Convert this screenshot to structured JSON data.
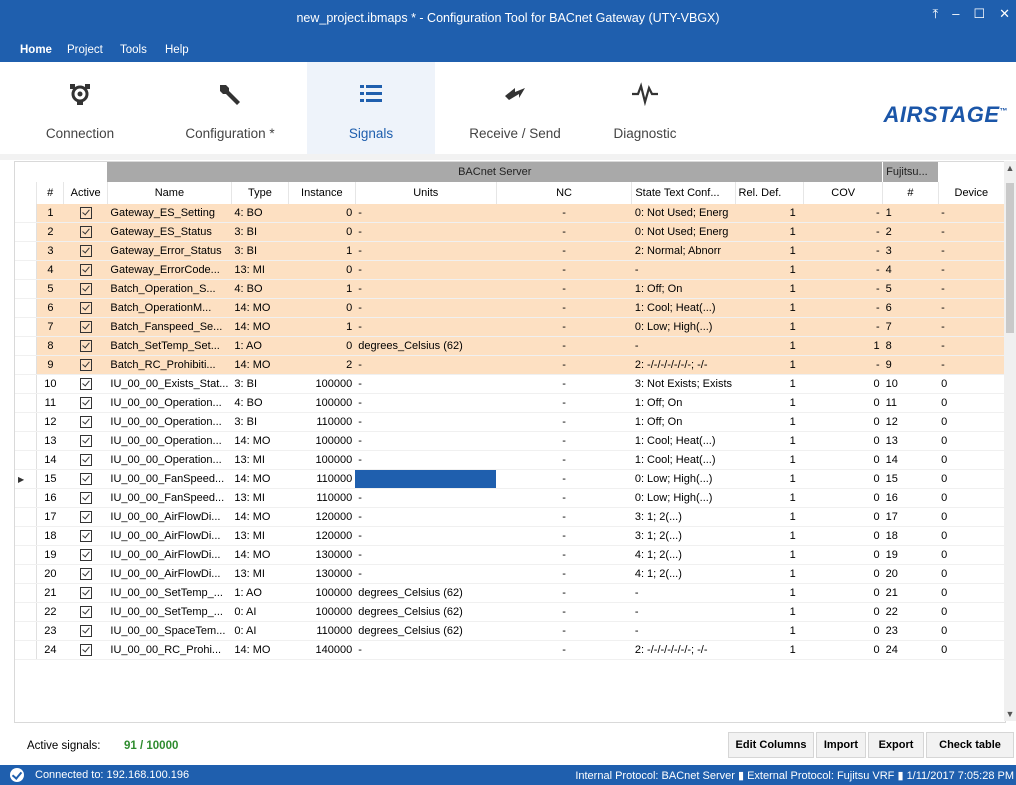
{
  "window": {
    "title": "new_project.ibmaps * - Configuration Tool for BACnet Gateway (UTY-VBGX)"
  },
  "menu": [
    "Home",
    "Project",
    "Tools",
    "Help"
  ],
  "ribbon": {
    "tabs": [
      {
        "label": "Connection",
        "icon": "connection-icon"
      },
      {
        "label": "Configuration *",
        "icon": "wrench-icon"
      },
      {
        "label": "Signals",
        "icon": "list-icon"
      },
      {
        "label": "Receive / Send",
        "icon": "transfer-icon"
      },
      {
        "label": "Diagnostic",
        "icon": "pulse-icon"
      }
    ],
    "active_tab": "Signals",
    "logo": "AIRSTAGE"
  },
  "grid": {
    "group_headers": {
      "bacnet": "BACnet Server",
      "fujitsu": "Fujitsu..."
    },
    "columns": [
      "#",
      "Active",
      "Name",
      "Type",
      "Instance",
      "Units",
      "NC",
      "State Text Conf...",
      "Rel. Def.",
      "COV",
      "#",
      "Device"
    ],
    "rows": [
      {
        "n": "1",
        "name": "Gateway_ES_Setting",
        "type": "4: BO",
        "instance": "0",
        "units": "-",
        "nc": "-",
        "state": "0: Not Used; Energ",
        "rel": "1",
        "cov": "-",
        "fnum": "1",
        "device": "-",
        "hl": true
      },
      {
        "n": "2",
        "name": "Gateway_ES_Status",
        "type": "3: BI",
        "instance": "0",
        "units": "-",
        "nc": "-",
        "state": "0: Not Used; Energ",
        "rel": "1",
        "cov": "-",
        "fnum": "2",
        "device": "-",
        "hl": true
      },
      {
        "n": "3",
        "name": "Gateway_Error_Status",
        "type": "3: BI",
        "instance": "1",
        "units": "-",
        "nc": "-",
        "state": "2: Normal; Abnorr",
        "rel": "1",
        "cov": "-",
        "fnum": "3",
        "device": "-",
        "hl": true
      },
      {
        "n": "4",
        "name": "Gateway_ErrorCode...",
        "type": "13: MI",
        "instance": "0",
        "units": "-",
        "nc": "-",
        "state": "-",
        "rel": "1",
        "cov": "-",
        "fnum": "4",
        "device": "-",
        "hl": true
      },
      {
        "n": "5",
        "name": "Batch_Operation_S...",
        "type": "4: BO",
        "instance": "1",
        "units": "-",
        "nc": "-",
        "state": "1: Off; On",
        "rel": "1",
        "cov": "-",
        "fnum": "5",
        "device": "-",
        "hl": true
      },
      {
        "n": "6",
        "name": "Batch_OperationM...",
        "type": "14: MO",
        "instance": "0",
        "units": "-",
        "nc": "-",
        "state": "1: Cool; Heat(...)",
        "rel": "1",
        "cov": "-",
        "fnum": "6",
        "device": "-",
        "hl": true
      },
      {
        "n": "7",
        "name": "Batch_Fanspeed_Se...",
        "type": "14: MO",
        "instance": "1",
        "units": "-",
        "nc": "-",
        "state": "0: Low; High(...)",
        "rel": "1",
        "cov": "-",
        "fnum": "7",
        "device": "-",
        "hl": true
      },
      {
        "n": "8",
        "name": "Batch_SetTemp_Set...",
        "type": "1: AO",
        "instance": "0",
        "units": "degrees_Celsius (62)",
        "nc": "-",
        "state": "-",
        "rel": "1",
        "cov": "1",
        "fnum": "8",
        "device": "-",
        "hl": true
      },
      {
        "n": "9",
        "name": "Batch_RC_Prohibiti...",
        "type": "14: MO",
        "instance": "2",
        "units": "-",
        "nc": "-",
        "state": "2: -/-/-/-/-/-/-; -/-",
        "rel": "1",
        "cov": "-",
        "fnum": "9",
        "device": "-",
        "hl": true
      },
      {
        "n": "10",
        "name": "IU_00_00_Exists_Stat...",
        "type": "3: BI",
        "instance": "100000",
        "units": "-",
        "nc": "-",
        "state": "3: Not Exists; Exists",
        "rel": "1",
        "cov": "0",
        "fnum": "10",
        "device": "0",
        "hl": false
      },
      {
        "n": "11",
        "name": "IU_00_00_Operation...",
        "type": "4: BO",
        "instance": "100000",
        "units": "-",
        "nc": "-",
        "state": "1: Off; On",
        "rel": "1",
        "cov": "0",
        "fnum": "11",
        "device": "0",
        "hl": false
      },
      {
        "n": "12",
        "name": "IU_00_00_Operation...",
        "type": "3: BI",
        "instance": "110000",
        "units": "-",
        "nc": "-",
        "state": "1: Off; On",
        "rel": "1",
        "cov": "0",
        "fnum": "12",
        "device": "0",
        "hl": false
      },
      {
        "n": "13",
        "name": "IU_00_00_Operation...",
        "type": "14: MO",
        "instance": "100000",
        "units": "-",
        "nc": "-",
        "state": "1: Cool; Heat(...)",
        "rel": "1",
        "cov": "0",
        "fnum": "13",
        "device": "0",
        "hl": false
      },
      {
        "n": "14",
        "name": "IU_00_00_Operation...",
        "type": "13: MI",
        "instance": "100000",
        "units": "-",
        "nc": "-",
        "state": "1: Cool; Heat(...)",
        "rel": "1",
        "cov": "0",
        "fnum": "14",
        "device": "0",
        "hl": false
      },
      {
        "n": "15",
        "name": "IU_00_00_FanSpeed...",
        "type": "14: MO",
        "instance": "110000",
        "units": "-",
        "nc": "-",
        "state": "0: Low; High(...)",
        "rel": "1",
        "cov": "0",
        "fnum": "15",
        "device": "0",
        "hl": false,
        "current": true
      },
      {
        "n": "16",
        "name": "IU_00_00_FanSpeed...",
        "type": "13: MI",
        "instance": "110000",
        "units": "-",
        "nc": "-",
        "state": "0: Low; High(...)",
        "rel": "1",
        "cov": "0",
        "fnum": "16",
        "device": "0",
        "hl": false
      },
      {
        "n": "17",
        "name": "IU_00_00_AirFlowDi...",
        "type": "14: MO",
        "instance": "120000",
        "units": "-",
        "nc": "-",
        "state": "3: 1; 2(...)",
        "rel": "1",
        "cov": "0",
        "fnum": "17",
        "device": "0",
        "hl": false
      },
      {
        "n": "18",
        "name": "IU_00_00_AirFlowDi...",
        "type": "13: MI",
        "instance": "120000",
        "units": "-",
        "nc": "-",
        "state": "3: 1; 2(...)",
        "rel": "1",
        "cov": "0",
        "fnum": "18",
        "device": "0",
        "hl": false
      },
      {
        "n": "19",
        "name": "IU_00_00_AirFlowDi...",
        "type": "14: MO",
        "instance": "130000",
        "units": "-",
        "nc": "-",
        "state": "4: 1; 2(...)",
        "rel": "1",
        "cov": "0",
        "fnum": "19",
        "device": "0",
        "hl": false
      },
      {
        "n": "20",
        "name": "IU_00_00_AirFlowDi...",
        "type": "13: MI",
        "instance": "130000",
        "units": "-",
        "nc": "-",
        "state": "4: 1; 2(...)",
        "rel": "1",
        "cov": "0",
        "fnum": "20",
        "device": "0",
        "hl": false
      },
      {
        "n": "21",
        "name": "IU_00_00_SetTemp_...",
        "type": "1: AO",
        "instance": "100000",
        "units": "degrees_Celsius (62)",
        "nc": "-",
        "state": "-",
        "rel": "1",
        "cov": "0",
        "fnum": "21",
        "device": "0",
        "hl": false
      },
      {
        "n": "22",
        "name": "IU_00_00_SetTemp_...",
        "type": "0: AI",
        "instance": "100000",
        "units": "degrees_Celsius (62)",
        "nc": "-",
        "state": "-",
        "rel": "1",
        "cov": "0",
        "fnum": "22",
        "device": "0",
        "hl": false
      },
      {
        "n": "23",
        "name": "IU_00_00_SpaceTem...",
        "type": "0: AI",
        "instance": "110000",
        "units": "degrees_Celsius (62)",
        "nc": "-",
        "state": "-",
        "rel": "1",
        "cov": "0",
        "fnum": "23",
        "device": "0",
        "hl": false
      },
      {
        "n": "24",
        "name": "IU_00_00_RC_Prohi...",
        "type": "14: MO",
        "instance": "140000",
        "units": "-",
        "nc": "-",
        "state": "2: -/-/-/-/-/-/-; -/-",
        "rel": "1",
        "cov": "0",
        "fnum": "24",
        "device": "0",
        "hl": false
      }
    ]
  },
  "footer": {
    "active_label": "Active signals:",
    "active_value": "91 / 10000",
    "buttons": [
      "Edit Columns",
      "Import",
      "Export",
      "Check table"
    ]
  },
  "status": {
    "connected": "Connected to: 192.168.100.196",
    "right": "Internal Protocol: BACnet Server  ▮  External Protocol: Fujitsu VRF  ▮  1/11/2017 7:05:28 PM"
  },
  "colors": {
    "accent": "#1f5fae",
    "highlight_row": "#fde0c2",
    "active_count": "#2e8b2e"
  }
}
